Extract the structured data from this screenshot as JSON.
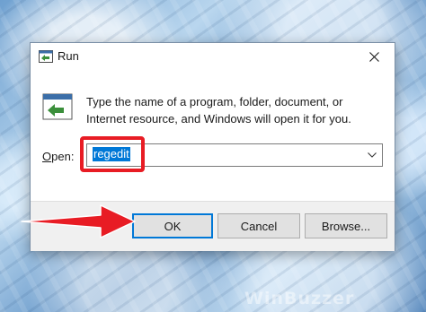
{
  "window": {
    "title": "Run",
    "close_glyph": "✕"
  },
  "prompt": {
    "text": "Type the name of a program, folder, document, or Internet resource, and Windows will open it for you."
  },
  "open_field": {
    "label_accel": "O",
    "label_rest": "pen:",
    "value": "regedit"
  },
  "buttons": {
    "ok": "OK",
    "cancel": "Cancel",
    "browse": "Browse..."
  },
  "annotations": {
    "highlight_color": "#e81c24",
    "arrow_color": "#e81c24"
  },
  "watermark": {
    "text": "WinBuzzer"
  },
  "colors": {
    "selection": "#0078d7",
    "footer": "#f0f0f0",
    "button": "#e1e1e1"
  }
}
